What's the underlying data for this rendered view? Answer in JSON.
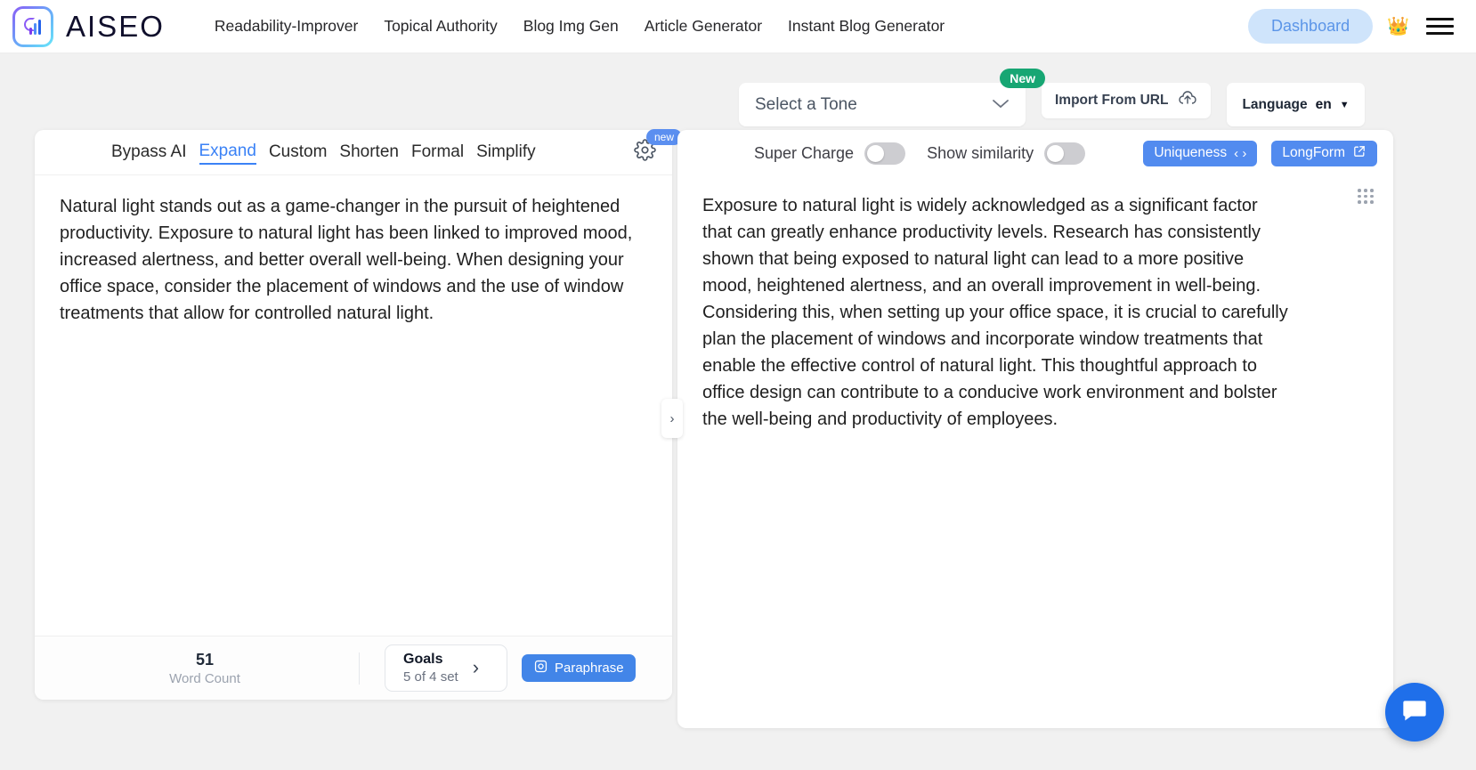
{
  "nav": {
    "brand": "AISEO",
    "brand_icon": "aiseo-logo-icon",
    "links": [
      {
        "label": "Readability-Improver"
      },
      {
        "label": "Topical Authority"
      },
      {
        "label": "Blog Img Gen"
      },
      {
        "label": "Article Generator"
      },
      {
        "label": "Instant Blog Generator"
      }
    ],
    "dashboard_label": "Dashboard",
    "crown_icon": "👑",
    "menu_icon": "hamburger-icon"
  },
  "toolbar": {
    "tone_placeholder": "Select a Tone",
    "tone_value": "",
    "tone_badge": "New",
    "import_label": "Import From URL",
    "language_label": "Language",
    "language_value": "en"
  },
  "left_panel": {
    "tabs": [
      {
        "label": "Bypass AI",
        "active": false
      },
      {
        "label": "Expand",
        "active": true
      },
      {
        "label": "Custom",
        "active": false
      },
      {
        "label": "Shorten",
        "active": false
      },
      {
        "label": "Formal",
        "active": false
      },
      {
        "label": "Simplify",
        "active": false
      }
    ],
    "settings_badge": "new",
    "text": "Natural light stands out as a game-changer in the pursuit of heightened productivity. Exposure to natural light has been linked to improved mood, increased alertness, and better overall well-being. When designing your office space, consider the placement of windows and the use of window treatments that allow for controlled natural light.",
    "word_count_value": "51",
    "word_count_label": "Word Count",
    "goals_title": "Goals",
    "goals_sub": "5 of 4 set",
    "paraphrase_label": "Paraphrase"
  },
  "right_panel": {
    "super_charge_label": "Super Charge",
    "super_charge_on": false,
    "show_similarity_label": "Show similarity",
    "show_similarity_on": false,
    "uniqueness_label": "Uniqueness",
    "longform_label": "LongForm",
    "text": "Exposure to natural light is widely acknowledged as a significant factor that can greatly enhance productivity levels. Research has consistently shown that being exposed to natural light can lead to a more positive mood, heightened alertness, and an overall improvement in well-being. Considering this, when setting up your office space, it is crucial to carefully plan the placement of windows and incorporate window treatments that enable the effective control of natural light. This thoughtful approach to office design can contribute to a conducive work environment and bolster the well-being and productivity of employees."
  },
  "colors": {
    "accent_blue": "#4285e8",
    "badge_green": "#17a673",
    "dashboard_bg": "#cfe4fb",
    "chat_blue": "#1f6fea"
  }
}
